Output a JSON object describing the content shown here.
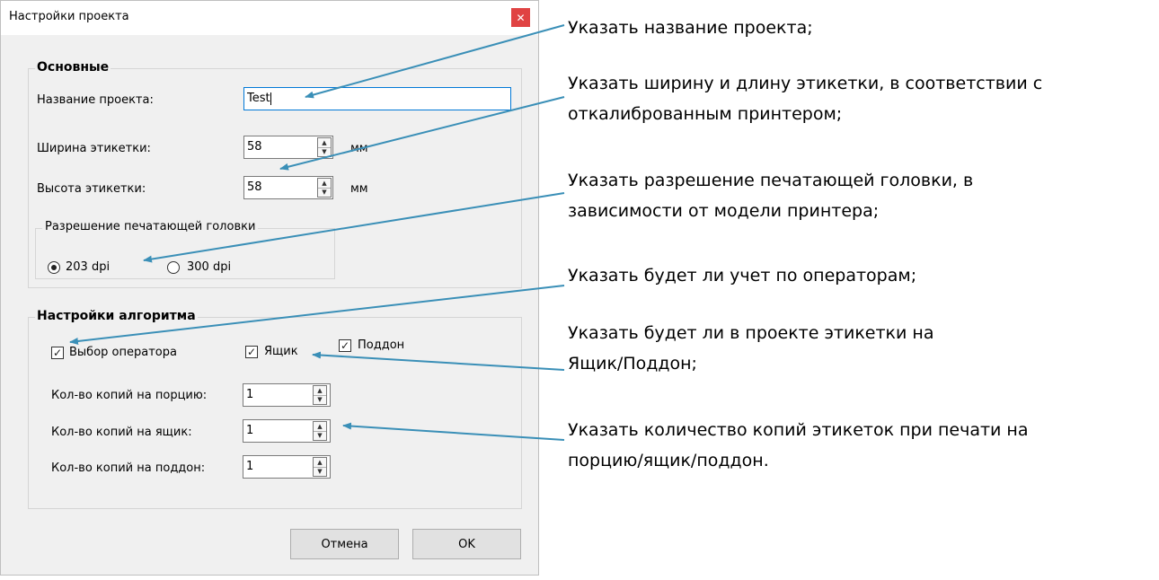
{
  "dialog": {
    "title": "Настройки проекта",
    "close_icon": "close-icon",
    "main_group": {
      "title": "Основные",
      "project_name_label": "Название проекта:",
      "project_name_value": "Test",
      "width_label": "Ширина этикетки:",
      "width_value": "58",
      "width_unit": "мм",
      "height_label": "Высота этикетки:",
      "height_value": "58",
      "height_unit": "мм"
    },
    "resolution_group": {
      "title": "Разрешение печатающей головки",
      "option_203": "203 dpi",
      "option_300": "300 dpi",
      "selected": "203 dpi"
    },
    "algorithm_group": {
      "title": "Настройки алгоритма",
      "operator_label": "Выбор оператора",
      "operator_checked": true,
      "box_label": "Ящик",
      "box_checked": true,
      "pallet_label": "Поддон",
      "pallet_checked": true,
      "copies_portion_label": "Кол-во копий на порцию:",
      "copies_portion_value": "1",
      "copies_box_label": "Кол-во копий на ящик:",
      "copies_box_value": "1",
      "copies_pallet_label": "Кол-во копий на поддон:",
      "copies_pallet_value": "1"
    },
    "buttons": {
      "cancel": "Отмена",
      "ok": "OK"
    }
  },
  "annotations": {
    "note1": "Указать название проекта;",
    "note2_line1": "Указать ширину и длину этикетки, в соответствии с",
    "note2_line2": "откалиброванным принтером;",
    "note3_line1": "Указать разрешение печатающей головки, в",
    "note3_line2": "зависимости от модели принтера;",
    "note4": "Указать будет ли учет по операторам;",
    "note5_line1": "Указать будет ли в проекте этикетки на",
    "note5_line2": "Ящик/Поддон;",
    "note6_line1": "Указать количество копий этикеток при печати на",
    "note6_line2": "порцию/ящик/поддон.",
    "arrow_color": "#3a8fb7"
  }
}
